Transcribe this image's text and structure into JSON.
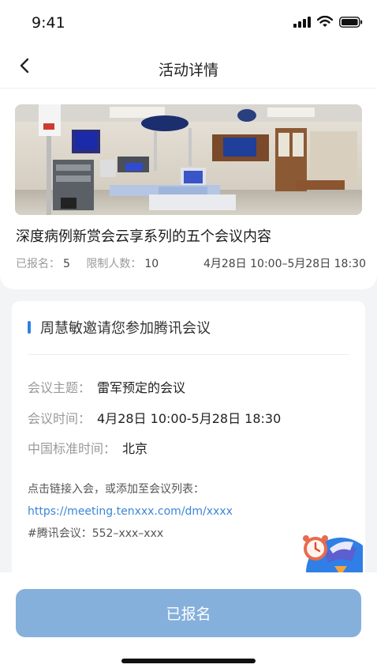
{
  "status_bar": {
    "time": "9:41",
    "icons": [
      "signal-icon",
      "wifi-icon",
      "battery-icon"
    ]
  },
  "nav": {
    "back_icon": "chevron-left-icon",
    "title": "活动详情"
  },
  "event": {
    "title": "深度病例新赏会云享系列的五个会议内容",
    "registered_label": "已报名：",
    "registered_count": "5",
    "limit_label": "限制人数：",
    "limit_count": "10",
    "time_range": "4月28日 10:00–5月28日 18:30"
  },
  "invite": {
    "heading": "周慧敏邀请您参加腾讯会议",
    "rows": [
      {
        "label": "会议主题：",
        "value": "雷军预定的会议"
      },
      {
        "label": "会议时间：",
        "value": "4月28日 10:00-5月28日 18:30"
      },
      {
        "label": "中国标准时间：",
        "value": "北京"
      }
    ],
    "link_hint": "点击链接入会，或添加至会议列表：",
    "link_url": "https://meeting.tenxxx.com/dm/xxxx",
    "meeting_id": "#腾讯会议：552–xxx–xxx"
  },
  "float_button": {
    "icon": "alarm-clock-icon"
  },
  "bottom": {
    "button_label": "已报名"
  },
  "colors": {
    "accent": "#2f7fe6",
    "button_bg": "#86b0dc",
    "link": "#3a86d8",
    "page_bg": "#f3f4f6"
  }
}
